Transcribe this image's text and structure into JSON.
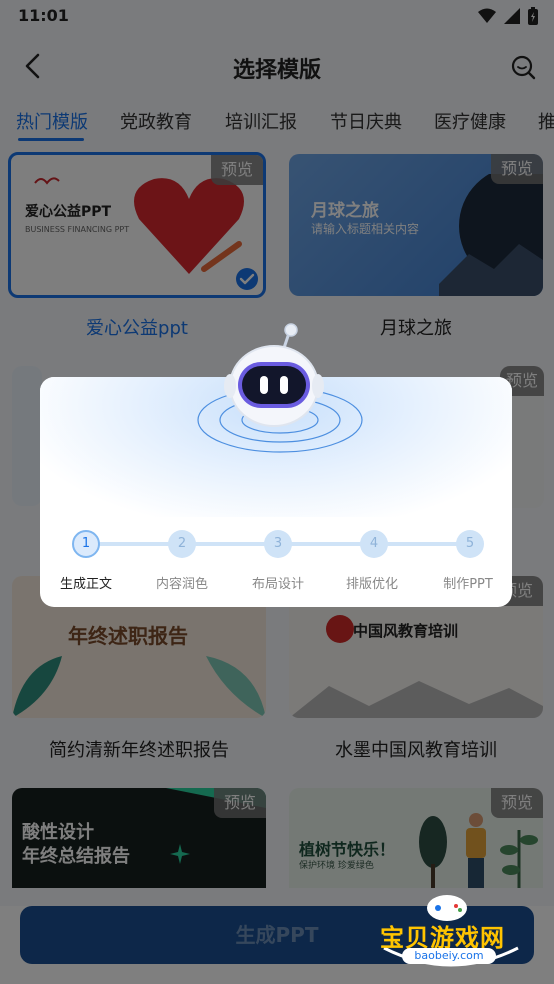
{
  "status": {
    "time": "11:01"
  },
  "header": {
    "title": "选择模版"
  },
  "tabs": [
    "热门模版",
    "党政教育",
    "培训汇报",
    "节日庆典",
    "医疗健康",
    "推"
  ],
  "preview_label": "预览",
  "templates": [
    {
      "title": "爱心公益ppt",
      "selected": true,
      "thumb_heading": "爱心公益PPT",
      "thumb_sub": "BUSINESS FINANCING PPT"
    },
    {
      "title": "月球之旅",
      "selected": false,
      "thumb_heading": "月球之旅",
      "thumb_sub": "请输入标题相关内容"
    },
    {
      "title": "简约清新年终述职报告",
      "selected": false,
      "thumb_heading": "年终述职报告"
    },
    {
      "title": "水墨中国风教育培训",
      "selected": false,
      "thumb_heading": "中国风教育培训"
    },
    {
      "thumb_heading": "酸性设计",
      "thumb_heading2": "年终总结报告"
    },
    {
      "thumb_heading": "植树节快乐！",
      "thumb_sub": "保护环境 珍爱绿色"
    }
  ],
  "dialog": {
    "steps": [
      {
        "num": "1",
        "label": "生成正文",
        "active": true
      },
      {
        "num": "2",
        "label": "内容润色",
        "active": false
      },
      {
        "num": "3",
        "label": "布局设计",
        "active": false
      },
      {
        "num": "4",
        "label": "排版优化",
        "active": false
      },
      {
        "num": "5",
        "label": "制作PPT",
        "active": false
      }
    ]
  },
  "button": {
    "generate": "生成PPT"
  },
  "watermark": {
    "text": "宝贝游戏网",
    "url": "baobeiy.com"
  },
  "colors": {
    "accent": "#1a73e8",
    "background": "#f4f6fa"
  }
}
